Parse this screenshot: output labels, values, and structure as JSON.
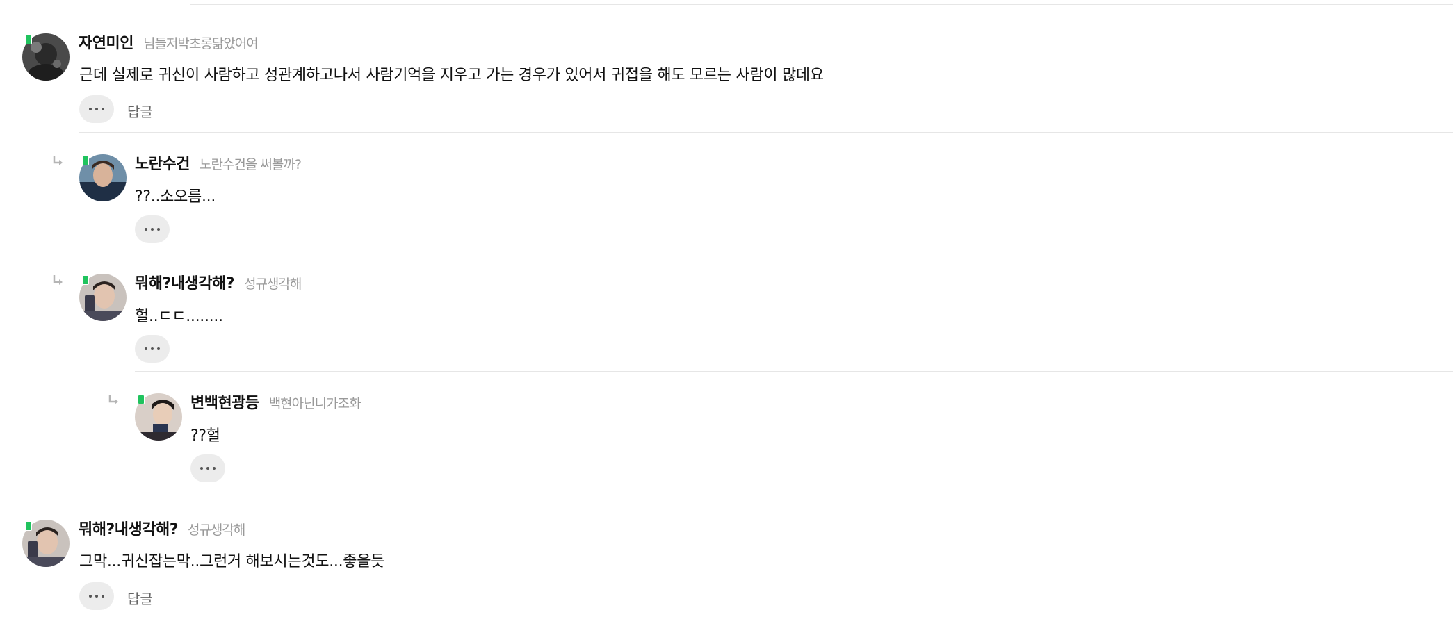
{
  "comments": [
    {
      "nickname": "자연미인",
      "sub_label": "님들저박초롱닮았어여",
      "text": "근데 실제로 귀신이 사람하고 성관계하고나서 사람기억을 지우고 가는 경우가 있어서 귀접을 해도 모르는 사람이 많데요",
      "reply_label": "답글"
    },
    {
      "nickname": "노란수건",
      "sub_label": "노란수건을 써볼까?",
      "text": "??..소오름..."
    },
    {
      "nickname": "뭐해?내생각해?",
      "sub_label": "성규생각해",
      "text": "헐..ㄷㄷ........"
    },
    {
      "nickname": "변백현광등",
      "sub_label": "백현아닌니가조화",
      "text": "??헐"
    },
    {
      "nickname": "뭐해?내생각해?",
      "sub_label": "성규생각해",
      "text": "그막...귀신잡는막..그런거 해보시는것도...좋을듯",
      "reply_label": "답글"
    }
  ],
  "colors": {
    "divider": "#e6e6e6",
    "badge": "#20c35e",
    "muted_text": "#999999",
    "button_bg": "#ececec"
  },
  "icons": {
    "reply_arrow": "reply-arrow-icon",
    "more": "more-dots-icon",
    "badge": "level-badge-icon"
  }
}
